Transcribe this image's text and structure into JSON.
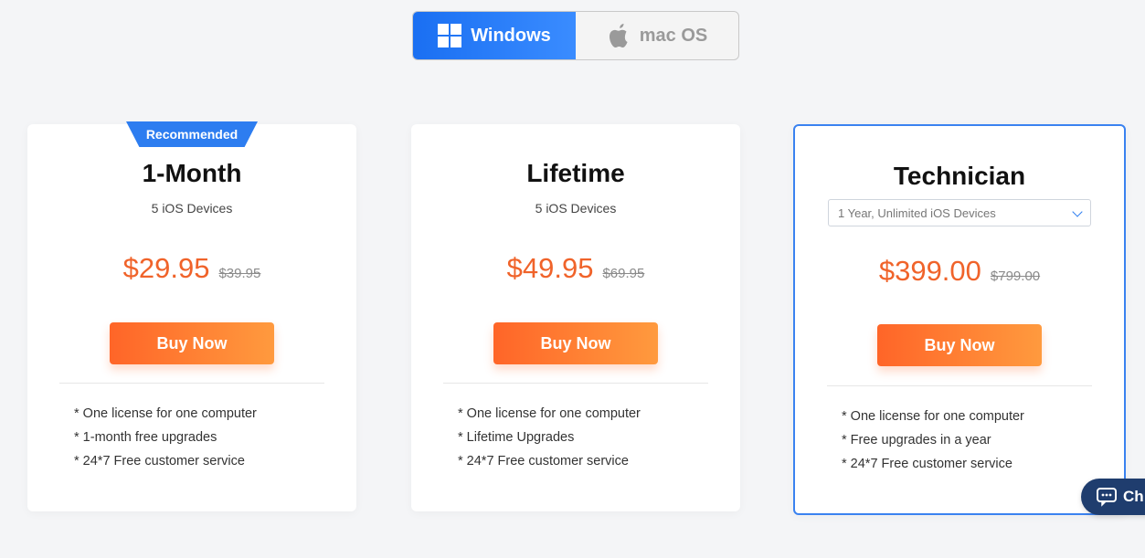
{
  "os_toggle": {
    "windows_label": "Windows",
    "mac_label": "mac OS",
    "active": "Windows"
  },
  "plans": [
    {
      "badge": "Recommended",
      "title": "1-Month",
      "subtitle": "5 iOS Devices",
      "price": "$29.95",
      "old_price": "$39.95",
      "button": "Buy Now",
      "features": [
        "* One license for one computer",
        "* 1-month free upgrades",
        "* 24*7 Free customer service"
      ]
    },
    {
      "title": "Lifetime",
      "subtitle": "5 iOS Devices",
      "price": "$49.95",
      "old_price": "$69.95",
      "button": "Buy Now",
      "features": [
        "* One license for one computer",
        "* Lifetime Upgrades",
        "* 24*7 Free customer service"
      ]
    },
    {
      "title": "Technician",
      "select_value": "1 Year, Unlimited iOS Devices",
      "price": "$399.00",
      "old_price": "$799.00",
      "button": "Buy Now",
      "features": [
        "* One license for one computer",
        "* Free upgrades in a year",
        "* 24*7 Free customer service"
      ]
    }
  ],
  "chat": {
    "label": "Ch"
  },
  "colors": {
    "accent_blue": "#2d7df0",
    "price_orange": "#f0632a",
    "button_orange": "#ff6528",
    "chat_navy": "#1f3d6e"
  }
}
